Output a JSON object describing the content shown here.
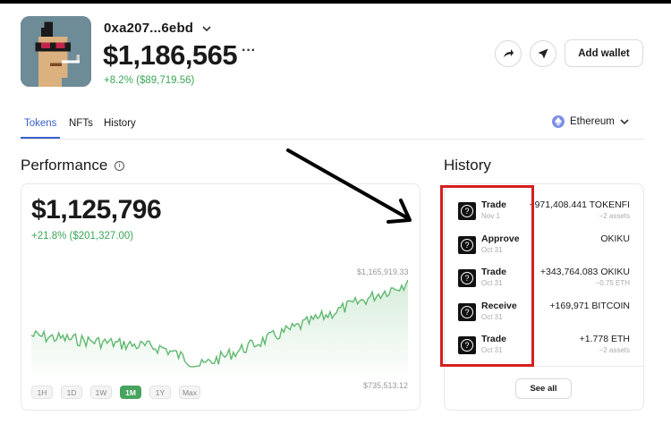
{
  "header": {
    "wallet_name": "0xa207...6ebd",
    "balance": "$1,186,565",
    "balance_more": "···",
    "balance_change": "+8.2% ($89,719.56)",
    "add_wallet_label": "Add wallet"
  },
  "tabs": [
    {
      "label": "Tokens",
      "active": true
    },
    {
      "label": "NFTs",
      "active": false
    },
    {
      "label": "History",
      "active": false
    }
  ],
  "network": {
    "label": "Ethereum",
    "icon": "ethereum-icon"
  },
  "performance": {
    "title": "Performance",
    "value": "$1,125,796",
    "change": "+21.8% ($201,327.00)",
    "chart_max_label": "$1,165,919.33",
    "chart_min_label": "$735,513.12",
    "ranges": [
      "1H",
      "1D",
      "1W",
      "1M",
      "1Y",
      "Max"
    ],
    "active_range": "1M",
    "line_color": "#5fb86f"
  },
  "history": {
    "title": "History",
    "items": [
      {
        "type": "Trade",
        "date": "Nov 1",
        "amount": "+971,408.441 TOKENFI",
        "sub": "−2 assets"
      },
      {
        "type": "Approve",
        "date": "Oct 31",
        "amount": "OKIKU",
        "sub": ""
      },
      {
        "type": "Trade",
        "date": "Oct 31",
        "amount": "+343,764.083 OKIKU",
        "sub": "−0.75 ETH"
      },
      {
        "type": "Receive",
        "date": "Oct 31",
        "amount": "+169,971 BITCOIN",
        "sub": ""
      },
      {
        "type": "Trade",
        "date": "Oct 31",
        "amount": "+1.778 ETH",
        "sub": "−2 assets"
      }
    ],
    "see_all_label": "See all"
  },
  "colors": {
    "accent": "#3a5fc9",
    "positive": "#3aa657",
    "highlight": "#d61f1f"
  }
}
